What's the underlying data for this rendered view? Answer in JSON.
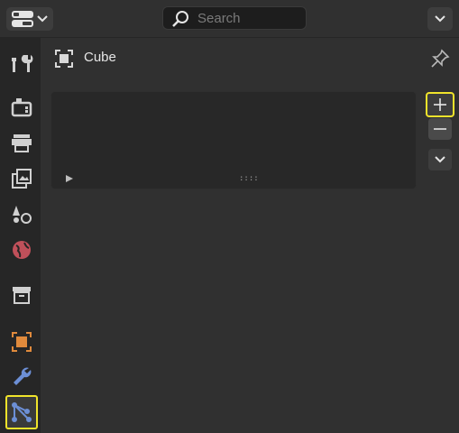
{
  "header": {
    "editor_type_icon": "editor-type-icon",
    "search_placeholder": "Search",
    "options_icon": "chevron-down-icon"
  },
  "sidebar": {
    "tabs": [
      {
        "name": "tool",
        "icon": "tool-icon",
        "active": false
      },
      {
        "name": "render",
        "icon": "render-icon",
        "active": false
      },
      {
        "name": "output",
        "icon": "output-icon",
        "active": false
      },
      {
        "name": "view-layer",
        "icon": "view-layer-icon",
        "active": false
      },
      {
        "name": "scene",
        "icon": "scene-icon",
        "active": false
      },
      {
        "name": "world",
        "icon": "world-icon",
        "active": false
      },
      {
        "name": "collection",
        "icon": "collection-icon",
        "active": false
      },
      {
        "name": "object",
        "icon": "object-icon",
        "active": false
      },
      {
        "name": "modifiers",
        "icon": "wrench-icon",
        "active": false
      },
      {
        "name": "object-data",
        "icon": "object-data-icon",
        "active": true
      }
    ]
  },
  "panel": {
    "object_name": "Cube",
    "list_grip": "::::",
    "buttons": {
      "add": "+",
      "remove": "−"
    }
  },
  "colors": {
    "background": "#303030",
    "sidebar": "#262626",
    "highlight": "#f0e32b",
    "object_orange": "#e08a3c",
    "modifier_blue": "#6c8fd6"
  }
}
